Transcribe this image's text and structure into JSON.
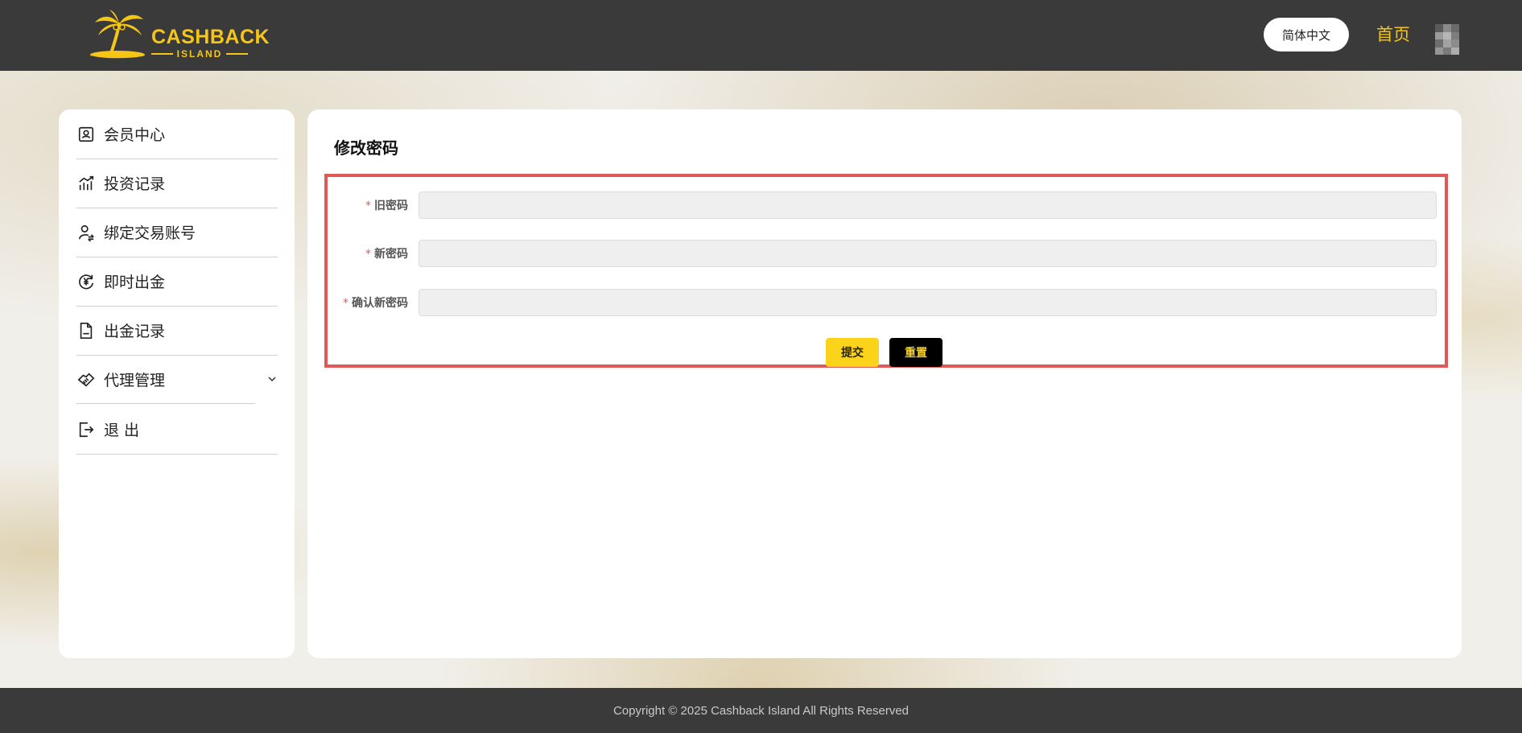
{
  "header": {
    "logo_text": "CASHBACK",
    "logo_subtext": "ISLAND",
    "language_button": "简体中文",
    "home_link": "首页",
    "colors": {
      "bar": "#3a3a3a",
      "accent": "#f5c518"
    }
  },
  "sidebar": {
    "items": [
      {
        "label": "会员中心",
        "icon": "member-card-icon"
      },
      {
        "label": "投资记录",
        "icon": "chart-icon"
      },
      {
        "label": "绑定交易账号",
        "icon": "user-transfer-icon"
      },
      {
        "label": "即时出金",
        "icon": "yen-coin-icon"
      },
      {
        "label": "出金记录",
        "icon": "document-icon"
      },
      {
        "label": "代理管理",
        "icon": "handshake-icon",
        "has_submenu": true
      },
      {
        "label": "退 出",
        "icon": "logout-icon"
      }
    ]
  },
  "main": {
    "title": "修改密码",
    "form": {
      "fields": [
        {
          "label": "旧密码",
          "required": "*",
          "value": "",
          "placeholder": ""
        },
        {
          "label": "新密码",
          "required": "*",
          "value": "",
          "placeholder": ""
        },
        {
          "label": "确认新密码",
          "required": "*",
          "value": "",
          "placeholder": ""
        }
      ],
      "submit_label": "提交",
      "reset_label": "重置"
    },
    "highlight_color": "#e05858"
  },
  "footer": {
    "copyright": "Copyright © 2025 Cashback Island All Rights Reserved"
  }
}
